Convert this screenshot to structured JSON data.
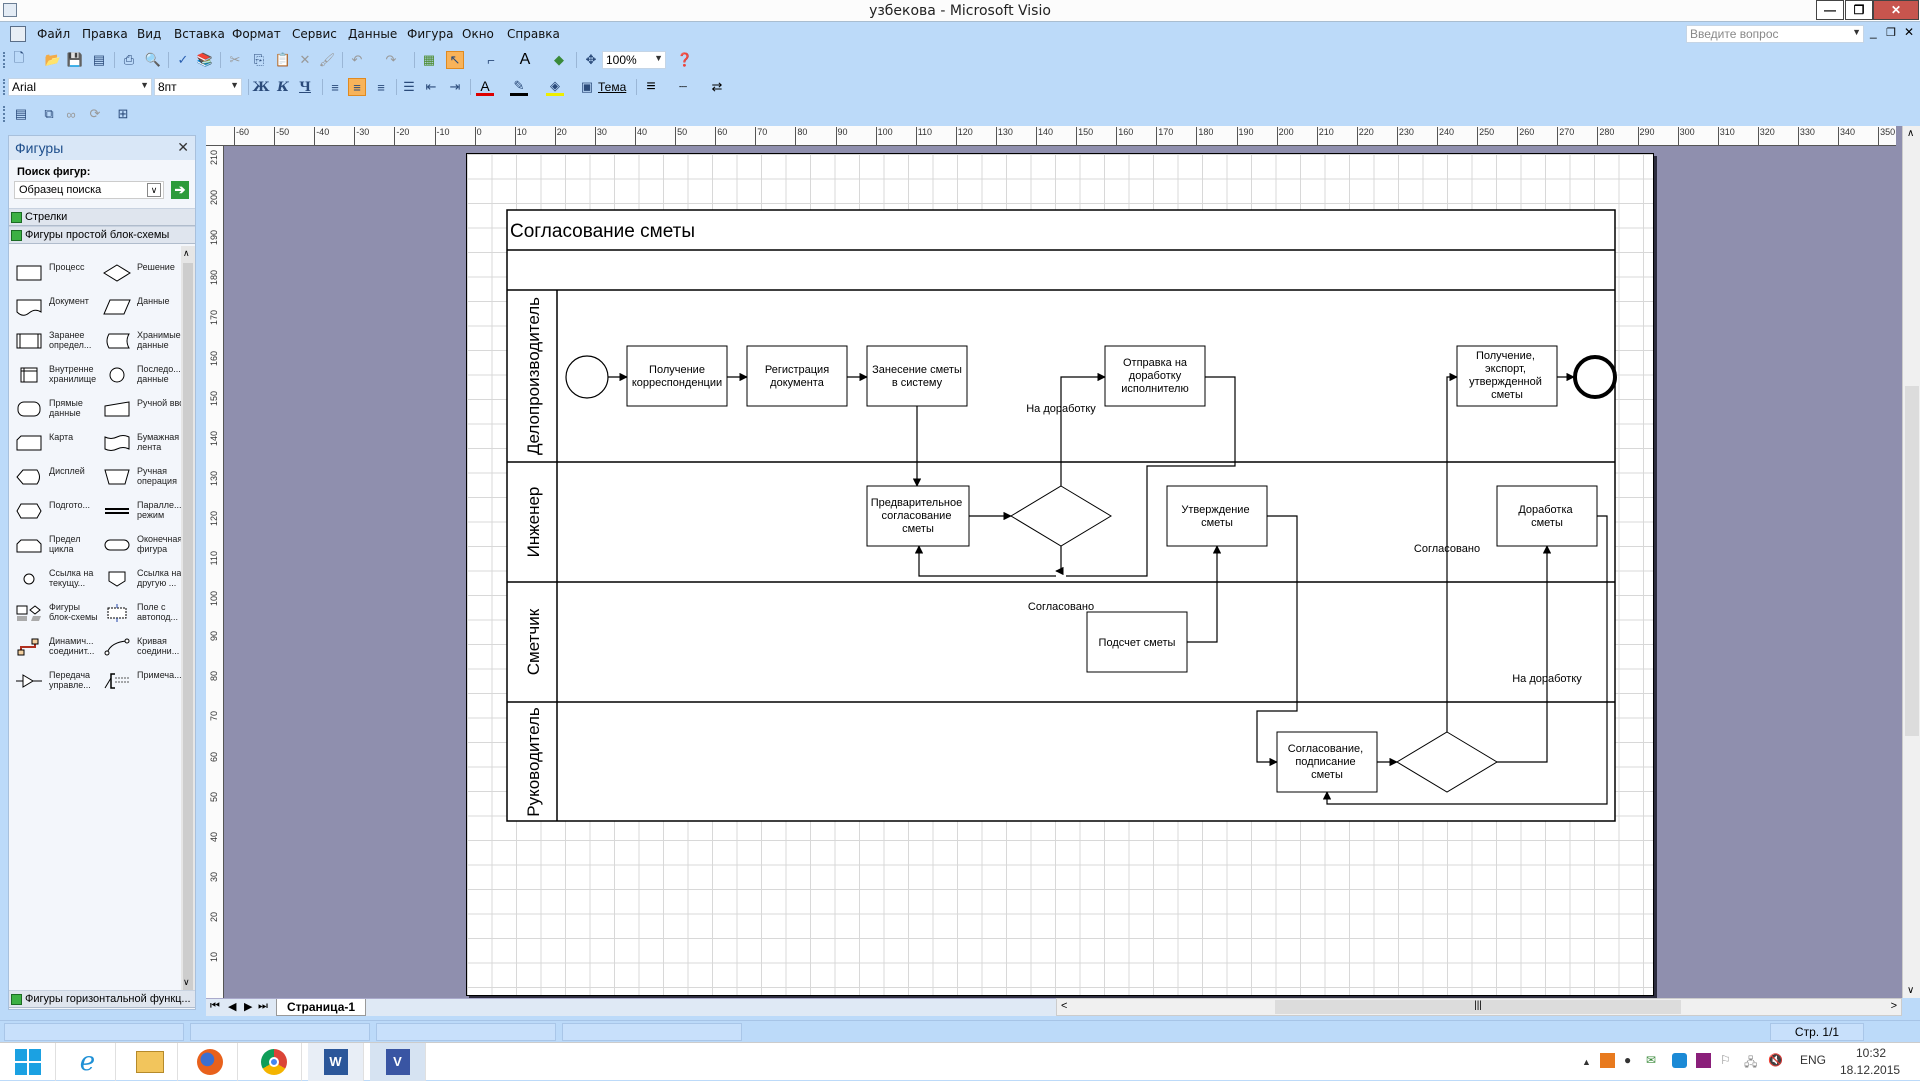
{
  "window": {
    "title": "узбекова - Microsoft Visio",
    "minimize": "—",
    "restore": "❐",
    "close": "✕"
  },
  "menubar": {
    "items": [
      "Файл",
      "Правка",
      "Вид",
      "Вставка",
      "Формат",
      "Сервис",
      "Данные",
      "Фигура",
      "Окно",
      "Справка"
    ],
    "help_search_placeholder": "Введите вопрос"
  },
  "toolbar_standard": {
    "zoom_value": "100%"
  },
  "toolbar_formatting": {
    "font": "Arial",
    "font_size": "8пт",
    "bold": "Ж",
    "italic": "К",
    "underline": "Ч",
    "theme": "Тема"
  },
  "sidebar": {
    "title": "Фигуры",
    "search_label": "Поиск фигур:",
    "search_value": "Образец поиска",
    "stencils": [
      "Стрелки",
      "Фигуры простой блок-схемы"
    ],
    "bottom_stencil": "Фигуры горизонтальной функц...",
    "shapes": [
      {
        "label": "Процесс",
        "icon": "process"
      },
      {
        "label": "Решение",
        "icon": "decision"
      },
      {
        "label": "Документ",
        "icon": "document"
      },
      {
        "label": "Данные",
        "icon": "data"
      },
      {
        "label": "Заранее определ...",
        "icon": "predefined"
      },
      {
        "label": "Хранимые данные",
        "icon": "stored-data"
      },
      {
        "label": "Внутренне хранилище",
        "icon": "internal-storage"
      },
      {
        "label": "Последо... данные",
        "icon": "sequential-data"
      },
      {
        "label": "Прямые данные",
        "icon": "direct-data"
      },
      {
        "label": "Ручной ввод",
        "icon": "manual-input"
      },
      {
        "label": "Карта",
        "icon": "card"
      },
      {
        "label": "Бумажная лента",
        "icon": "paper-tape"
      },
      {
        "label": "Дисплей",
        "icon": "display"
      },
      {
        "label": "Ручная операция",
        "icon": "manual-operation"
      },
      {
        "label": "Подгото...",
        "icon": "preparation"
      },
      {
        "label": "Паралле... режим",
        "icon": "parallel-mode"
      },
      {
        "label": "Предел цикла",
        "icon": "loop-limit"
      },
      {
        "label": "Оконечная фигура",
        "icon": "terminator"
      },
      {
        "label": "Ссылка на текущу...",
        "icon": "on-page-reference"
      },
      {
        "label": "Ссылка на другую ...",
        "icon": "off-page-reference"
      },
      {
        "label": "Фигуры блок-схемы",
        "icon": "flowchart-shapes"
      },
      {
        "label": "Поле с автопод...",
        "icon": "auto-height-box"
      },
      {
        "label": "Динамич... соединит...",
        "icon": "dynamic-connector"
      },
      {
        "label": "Кривая соедини...",
        "icon": "curved-connector"
      },
      {
        "label": "Передача управле...",
        "icon": "control-transfer"
      },
      {
        "label": "Примеча...",
        "icon": "annotation"
      }
    ]
  },
  "rulers": {
    "horizontal": [
      "-60",
      "-50",
      "-40",
      "-30",
      "-20",
      "-10",
      "0",
      "10",
      "20",
      "30",
      "40",
      "50",
      "60",
      "70",
      "80",
      "90",
      "100",
      "110",
      "120",
      "130",
      "140",
      "150",
      "160",
      "170",
      "180",
      "190",
      "200",
      "210",
      "220",
      "230",
      "240",
      "250",
      "260",
      "270",
      "280",
      "290",
      "300",
      "310",
      "320",
      "330",
      "340",
      "350"
    ],
    "vertical": [
      "210",
      "200",
      "190",
      "180",
      "170",
      "160",
      "150",
      "140",
      "130",
      "120",
      "110",
      "100",
      "90",
      "80",
      "70",
      "60",
      "50",
      "40",
      "30",
      "20",
      "10"
    ]
  },
  "diagram": {
    "title": "Согласование сметы",
    "lanes": [
      "Делопроизводитель",
      "Инженер",
      "Сметчик",
      "Руководитель"
    ],
    "shapes": {
      "receive": "Получение корреспонденции",
      "register": "Регистрация документа",
      "enter": "Занесение сметы в систему",
      "send_back": "Отправка на доработку исполнителю",
      "receive_export_1": "Получение,",
      "receive_export_2": "экспорт,",
      "receive_export_3": "утвержденной",
      "receive_export_4": "сметы",
      "prelim_1": "Предварительное",
      "prelim_2": "согласование",
      "prelim_3": "сметы",
      "approve_1": "Утверждение",
      "approve_2": "сметы",
      "rework_1": "Доработка",
      "rework_2": "сметы",
      "calc": "Подсчет сметы",
      "sign_1": "Согласование,",
      "sign_2": "подписание",
      "sign_3": "сметы"
    },
    "labels": {
      "rework_1": "На доработку",
      "agreed_1": "Согласовано",
      "agreed_2": "Согласовано",
      "rework_2": "На доработку"
    }
  },
  "page_tabs": {
    "current": "Страница-1"
  },
  "statusbar": {
    "page": "Стр. 1/1"
  },
  "taskbar": {
    "apps": [
      "start",
      "internet-explorer",
      "file-explorer",
      "firefox",
      "chrome",
      "word",
      "visio"
    ],
    "language": "ENG",
    "time": "10:32",
    "date": "18.12.2015"
  }
}
